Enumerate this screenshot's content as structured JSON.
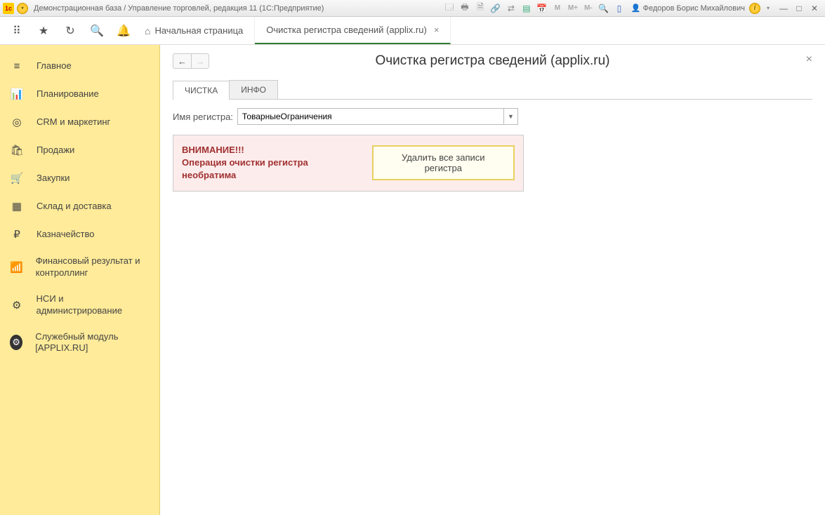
{
  "titlebar": {
    "title": "Демонстрационная база / Управление торговлей, редакция 11  (1С:Предприятие)",
    "user": "Федоров Борис Михайлович",
    "m_labels": [
      "M",
      "M+",
      "M-"
    ]
  },
  "tabs": {
    "home": "Начальная страница",
    "active": "Очистка регистра сведений (applix.ru)"
  },
  "sidebar": {
    "items": [
      {
        "icon": "≡",
        "label": "Главное"
      },
      {
        "icon": "📊",
        "label": "Планирование"
      },
      {
        "icon": "◎",
        "label": "CRM и маркетинг"
      },
      {
        "icon": "🛍",
        "label": "Продажи"
      },
      {
        "icon": "🛒",
        "label": "Закупки"
      },
      {
        "icon": "▦",
        "label": "Склад и доставка"
      },
      {
        "icon": "₽",
        "label": "Казначейство"
      },
      {
        "icon": "📶",
        "label": "Финансовый результат и контроллинг"
      },
      {
        "icon": "⚙",
        "label": "НСИ и администрирование"
      },
      {
        "icon": "⚙",
        "label": "Служебный модуль [APPLIX.RU]"
      }
    ]
  },
  "content": {
    "page_title": "Очистка регистра сведений (applix.ru)",
    "tabs": [
      "ЧИСТКА",
      "ИНФО"
    ],
    "field_label": "Имя регистра:",
    "field_value": "ТоварныеОграничения",
    "warning_line1": "ВНИМАНИЕ!!!",
    "warning_line2": "Операция очистки регистра необратима",
    "delete_button": "Удалить все записи регистра"
  }
}
